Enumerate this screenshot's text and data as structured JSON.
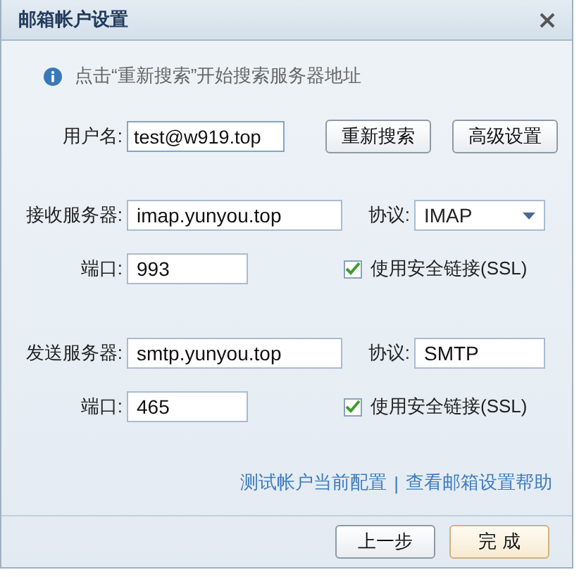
{
  "window": {
    "title": "邮箱帐户设置"
  },
  "info": "点击“重新搜索”开始搜索服务器地址",
  "username": {
    "label": "用户名:",
    "value": "test@w919.top",
    "focused": true
  },
  "buttons": [
    {
      "label": "重新搜索"
    },
    {
      "label": "高级设置"
    }
  ],
  "servers": [
    {
      "label": "接收服务器:",
      "value": "imap.yunyou.top",
      "protocol_label": "协议:",
      "protocol": {
        "kind": "dropdown",
        "value": "IMAP"
      },
      "port_label": "端口:",
      "port": "993",
      "ssl": {
        "label": "使用安全链接(SSL)",
        "checked": true
      }
    },
    {
      "label": "发送服务器:",
      "value": "smtp.yunyou.top",
      "protocol_label": "协议:",
      "protocol": {
        "kind": "field",
        "value": "SMTP"
      },
      "port_label": "端口:",
      "port": "465",
      "ssl": {
        "label": "使用安全链接(SSL)",
        "checked": true
      }
    }
  ],
  "links": [
    {
      "text": "测试帐户当前配置"
    },
    {
      "text": "查看邮箱设置帮助"
    }
  ],
  "link_separator": "|",
  "footer_buttons": [
    {
      "label": "上一步",
      "primary": false
    },
    {
      "label": "完 成",
      "primary": true
    }
  ]
}
